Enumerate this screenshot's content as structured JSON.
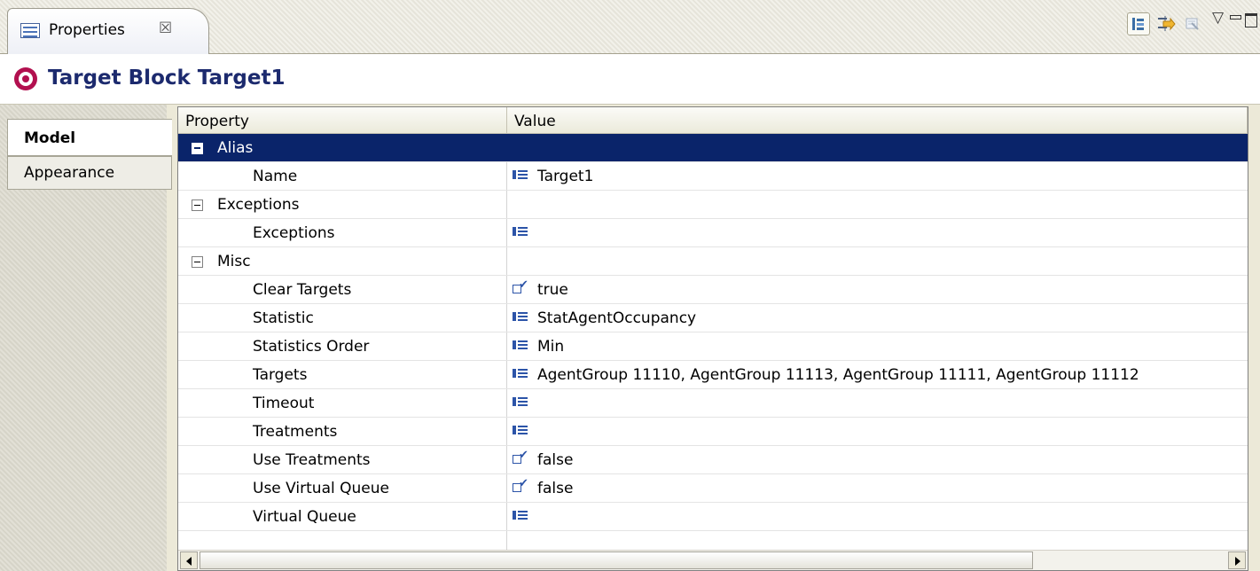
{
  "view_tab": {
    "title": "Properties",
    "close_glyph": "☒"
  },
  "toolbar": {
    "buttons": [
      {
        "name": "show-categories",
        "icon": "tree-categories-icon",
        "active": true
      },
      {
        "name": "show-advanced",
        "icon": "filter-advanced-icon",
        "active": false
      },
      {
        "name": "restore-default",
        "icon": "restore-default-icon",
        "active": false
      }
    ],
    "menu_glyph": "▽",
    "minimize_glyph": "▭",
    "maximize_glyph": "☐"
  },
  "header": {
    "title": "Target Block Target1",
    "icon": "target-icon"
  },
  "side_tabs": [
    {
      "label": "Model",
      "selected": true
    },
    {
      "label": "Appearance",
      "selected": false
    }
  ],
  "table": {
    "columns": [
      "Property",
      "Value"
    ],
    "rows": [
      {
        "type": "category",
        "property": "Alias",
        "value": "",
        "selected": true
      },
      {
        "type": "leaf",
        "property": "Name",
        "icon": "list",
        "value": "Target1"
      },
      {
        "type": "category",
        "property": "Exceptions",
        "value": ""
      },
      {
        "type": "leaf",
        "property": "Exceptions",
        "icon": "list",
        "value": ""
      },
      {
        "type": "category",
        "property": "Misc",
        "value": ""
      },
      {
        "type": "leaf",
        "property": "Clear Targets",
        "icon": "bool",
        "value": "true"
      },
      {
        "type": "leaf",
        "property": "Statistic",
        "icon": "list",
        "value": "StatAgentOccupancy"
      },
      {
        "type": "leaf",
        "property": "Statistics Order",
        "icon": "list",
        "value": "Min"
      },
      {
        "type": "leaf",
        "property": "Targets",
        "icon": "list",
        "value": "AgentGroup 11110, AgentGroup 11113, AgentGroup 11111, AgentGroup 11112"
      },
      {
        "type": "leaf",
        "property": "Timeout",
        "icon": "list",
        "value": ""
      },
      {
        "type": "leaf",
        "property": "Treatments",
        "icon": "list",
        "value": ""
      },
      {
        "type": "leaf",
        "property": "Use Treatments",
        "icon": "bool",
        "value": "false"
      },
      {
        "type": "leaf",
        "property": "Use Virtual Queue",
        "icon": "bool",
        "value": "false"
      },
      {
        "type": "leaf",
        "property": "Virtual Queue",
        "icon": "list",
        "value": ""
      }
    ]
  },
  "colors": {
    "selection": "#0a246a",
    "header_title": "#1c2a6e",
    "target_icon": "#b2104f",
    "value_icon": "#2c54a8"
  }
}
